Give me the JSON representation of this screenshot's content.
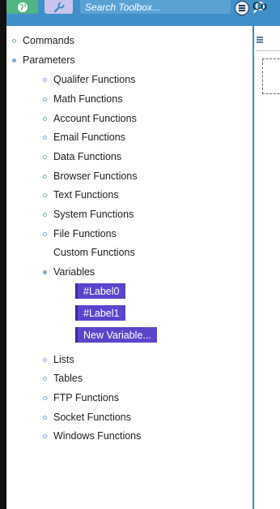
{
  "toolbar": {
    "search_placeholder": "Search Toolbox...",
    "code_tab_label": "Co",
    "accent_color": "#3f8fc9"
  },
  "tree": {
    "commands": "Commands",
    "parameters": "Parameters",
    "functions": [
      "Qualifer Functions",
      "Math Functions",
      "Account Functions",
      "Email Functions",
      "Data Functions",
      "Browser Functions",
      "Text Functions",
      "System Functions",
      "File Functions",
      "Custom Functions"
    ],
    "variables": "Variables",
    "variable_items": [
      "#Label0",
      "#Label1",
      "New Variable..."
    ],
    "after": [
      "Lists",
      "Tables",
      "FTP Functions",
      "Socket Functions",
      "Windows Functions"
    ]
  },
  "icons": [
    "globe-icon",
    "wrench-icon",
    "search-icon",
    "hamburger-icon"
  ],
  "colors": {
    "variable_chip": "#5b44cc",
    "bullet": "#7fa8d6"
  }
}
